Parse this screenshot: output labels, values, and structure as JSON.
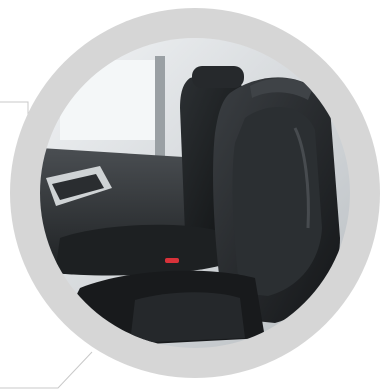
{
  "image": {
    "subject": "car-interior-seats-photo",
    "colors": {
      "ring": "#d6d6d6",
      "background": "#ffffff",
      "seat_leather": "#1f2224",
      "seat_highlight": "#3a3d40",
      "window_light": "#eef2f4",
      "accent_red": "#d8323a"
    }
  }
}
